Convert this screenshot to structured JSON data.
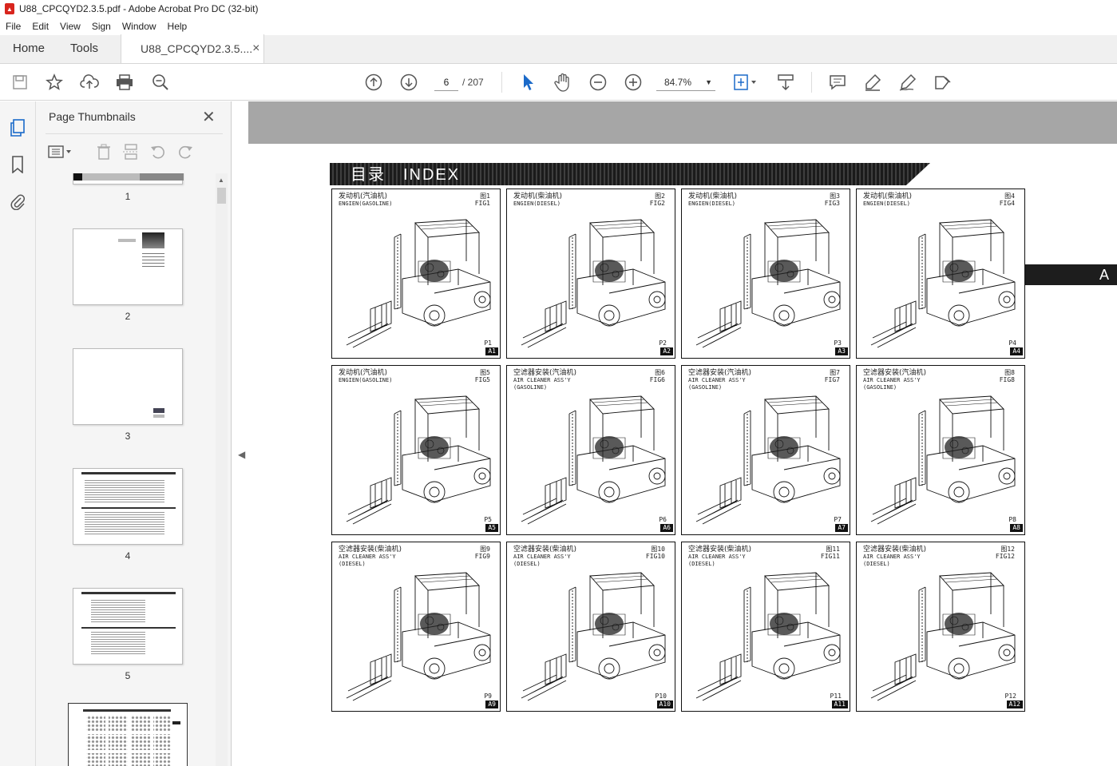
{
  "window": {
    "title": "U88_CPCQYD2.3.5.pdf - Adobe Acrobat Pro DC (32-bit)"
  },
  "menu": [
    "File",
    "Edit",
    "View",
    "Sign",
    "Window",
    "Help"
  ],
  "tabs": {
    "home": "Home",
    "tools": "Tools",
    "document": "U88_CPCQYD2.3.5....",
    "close": "×"
  },
  "toolbar": {
    "current_page": "6",
    "total_pages": "/ 207",
    "zoom": "84.7%"
  },
  "panel": {
    "title": "Page Thumbnails",
    "thumbnails": [
      {
        "label": "1"
      },
      {
        "label": "2"
      },
      {
        "label": "3"
      },
      {
        "label": "4"
      },
      {
        "label": "5"
      }
    ]
  },
  "page": {
    "banner": "目录　INDEX",
    "side_tab": "A",
    "figures": [
      {
        "cn": "发动机(汽油机)",
        "en": "ENGIEN(GASOLINE)",
        "fig": "图1\nFIG1",
        "p": "P1",
        "code": "A1"
      },
      {
        "cn": "发动机(柴油机)",
        "en": "ENGIEN(DIESEL)",
        "fig": "图2\nFIG2",
        "p": "P2",
        "code": "A2"
      },
      {
        "cn": "发动机(柴油机)",
        "en": "ENGIEN(DIESEL)",
        "fig": "图3\nFIG3",
        "p": "P3",
        "code": "A3"
      },
      {
        "cn": "发动机(柴油机)",
        "en": "ENGIEN(DIESEL)",
        "fig": "图4\nFIG4",
        "p": "P4",
        "code": "A4"
      },
      {
        "cn": "发动机(汽油机)",
        "en": "ENGIEN(GASOLINE)",
        "fig": "图5\nFIG5",
        "p": "P5",
        "code": "A5"
      },
      {
        "cn": "空滤器安装(汽油机)",
        "en": "AIR CLEANER ASS'Y\n(GASOLINE)",
        "fig": "图6\nFIG6",
        "p": "P6",
        "code": "A6"
      },
      {
        "cn": "空滤器安装(汽油机)",
        "en": "AIR CLEANER ASS'Y\n(GASOLINE)",
        "fig": "图7\nFIG7",
        "p": "P7",
        "code": "A7"
      },
      {
        "cn": "空滤器安装(汽油机)",
        "en": "AIR CLEANER ASS'Y\n(GASOLINE)",
        "fig": "图8\nFIG8",
        "p": "P8",
        "code": "A8"
      },
      {
        "cn": "空滤器安装(柴油机)",
        "en": "AIR CLEANER ASS'Y\n(DIESEL)",
        "fig": "图9\nFIG9",
        "p": "P9",
        "code": "A9"
      },
      {
        "cn": "空滤器安装(柴油机)",
        "en": "AIR CLEANER ASS'Y\n(DIESEL)",
        "fig": "图10\nFIG10",
        "p": "P10",
        "code": "A10"
      },
      {
        "cn": "空滤器安装(柴油机)",
        "en": "AIR CLEANER ASS'Y\n(DIESEL)",
        "fig": "图11\nFIG11",
        "p": "P11",
        "code": "A11"
      },
      {
        "cn": "空滤器安装(柴油机)",
        "en": "AIR CLEANER ASS'Y\n(DIESEL)",
        "fig": "图12\nFIG12",
        "p": "P12",
        "code": "A12"
      }
    ]
  },
  "icons": {
    "save": "save-icon",
    "star": "bookmark-star-icon",
    "upload": "cloud-upload-icon",
    "print": "print-icon",
    "search": "zoom-search-icon",
    "prev": "page-up-icon",
    "next": "page-down-icon",
    "select": "cursor-icon",
    "hand": "hand-icon",
    "zoomout": "zoom-out-icon",
    "zoomin": "zoom-in-icon",
    "fit": "fit-page-icon",
    "scroll": "scroll-mode-icon",
    "comment": "comment-icon",
    "highlight": "highlight-icon",
    "sign": "sign-icon",
    "fill": "fill-sign-icon"
  }
}
